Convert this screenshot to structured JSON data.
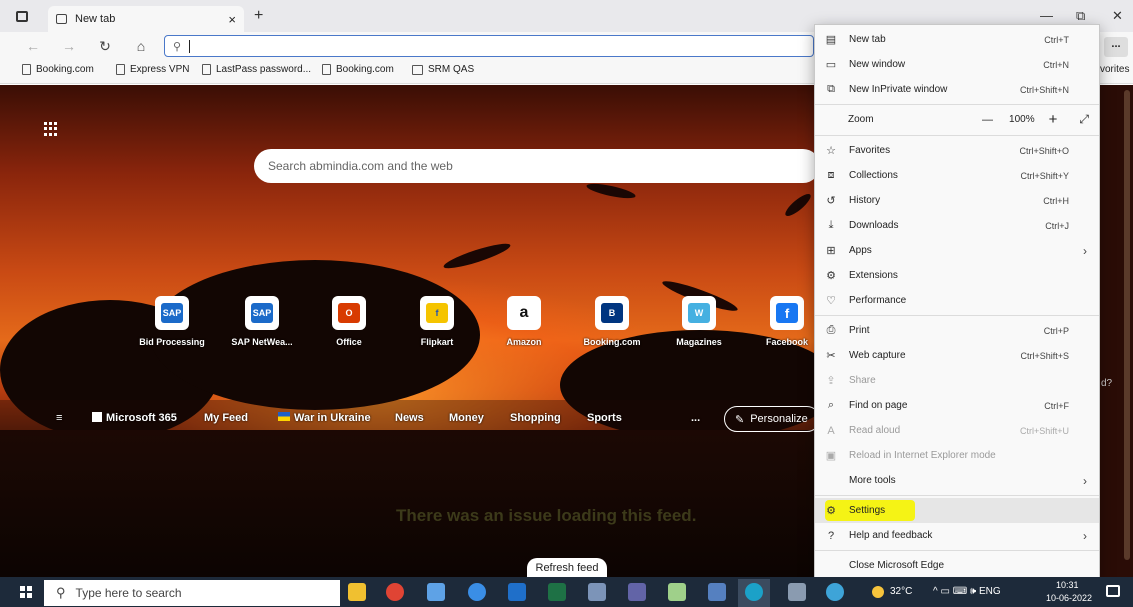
{
  "browser": {
    "tab_title": "New tab",
    "tab_close": "×",
    "new_tab": "+",
    "minimize": "—",
    "restore": "⧉",
    "close": "✕",
    "more": "..."
  },
  "toolbar": {
    "back": "←",
    "forward": "→",
    "refresh": "↻",
    "home": "⌂",
    "address_value": ""
  },
  "favorites": [
    "Booking.com",
    "Express VPN",
    "LastPass password...",
    "Booking.com",
    "SRM QAS"
  ],
  "favorites_right": "vorites",
  "newtab": {
    "search_placeholder": "Search abmindia.com and the web",
    "tiles": [
      {
        "label": "Bid Processing",
        "icon": "SAP",
        "color": "#1b6ac9"
      },
      {
        "label": "SAP NetWea...",
        "icon": "SAP",
        "color": "#1b6ac9"
      },
      {
        "label": "Office",
        "icon": "O",
        "color": "#d83b01"
      },
      {
        "label": "Flipkart",
        "icon": "f",
        "color": "#f5c400"
      },
      {
        "label": "Amazon",
        "icon": "a",
        "color": "#ffffff"
      },
      {
        "label": "Booking.com",
        "icon": "B",
        "color": "#003580"
      },
      {
        "label": "Magazines",
        "icon": "W",
        "color": "#45b0e1"
      },
      {
        "label": "Facebook",
        "icon": "f",
        "color": "#1877f2"
      }
    ],
    "feed_nav": [
      "Microsoft 365",
      "My Feed",
      "War in Ukraine",
      "News",
      "Money",
      "Shopping",
      "Sports"
    ],
    "feed_more": "...",
    "personalize": "Personalize",
    "issue": "There was an issue loading this feed.",
    "refresh_feed": "Refresh feed",
    "partial_right": "d?"
  },
  "menu": {
    "items": [
      {
        "label": "New tab",
        "shortcut": "Ctrl+T",
        "icon": "tab-icon"
      },
      {
        "label": "New window",
        "shortcut": "Ctrl+N",
        "icon": "window-icon"
      },
      {
        "label": "New InPrivate window",
        "shortcut": "Ctrl+Shift+N",
        "icon": "inprivate-icon"
      },
      {
        "label": "Favorites",
        "shortcut": "Ctrl+Shift+O",
        "icon": "favorites-icon"
      },
      {
        "label": "Collections",
        "shortcut": "Ctrl+Shift+Y",
        "icon": "collections-icon"
      },
      {
        "label": "History",
        "shortcut": "Ctrl+H",
        "icon": "history-icon"
      },
      {
        "label": "Downloads",
        "shortcut": "Ctrl+J",
        "icon": "downloads-icon"
      },
      {
        "label": "Apps",
        "shortcut": "",
        "icon": "apps-icon"
      },
      {
        "label": "Extensions",
        "shortcut": "",
        "icon": "extensions-icon"
      },
      {
        "label": "Performance",
        "shortcut": "",
        "icon": "performance-icon"
      },
      {
        "label": "Print",
        "shortcut": "Ctrl+P",
        "icon": "print-icon"
      },
      {
        "label": "Web capture",
        "shortcut": "Ctrl+Shift+S",
        "icon": "web-capture-icon"
      },
      {
        "label": "Share",
        "shortcut": "",
        "icon": "share-icon"
      },
      {
        "label": "Find on page",
        "shortcut": "Ctrl+F",
        "icon": "find-icon"
      },
      {
        "label": "Read aloud",
        "shortcut": "Ctrl+Shift+U",
        "icon": "read-aloud-icon"
      },
      {
        "label": "Reload in Internet Explorer mode",
        "shortcut": "",
        "icon": "ie-mode-icon"
      },
      {
        "label": "More tools",
        "shortcut": "",
        "icon": ""
      },
      {
        "label": "Settings",
        "shortcut": "",
        "icon": "gear-icon"
      },
      {
        "label": "Help and feedback",
        "shortcut": "",
        "icon": "help-icon"
      },
      {
        "label": "Close Microsoft Edge",
        "shortcut": "",
        "icon": ""
      }
    ],
    "zoom": {
      "label": "Zoom",
      "minus": "—",
      "value": "100%",
      "plus": "+",
      "fullscreen": "⤢"
    }
  },
  "taskbar": {
    "search_placeholder": "Type here to search",
    "weather": "32°C",
    "tray": "^ ▭ ⌨ 🕪 ENG",
    "time": "10:31",
    "date": "10-06-2022"
  }
}
